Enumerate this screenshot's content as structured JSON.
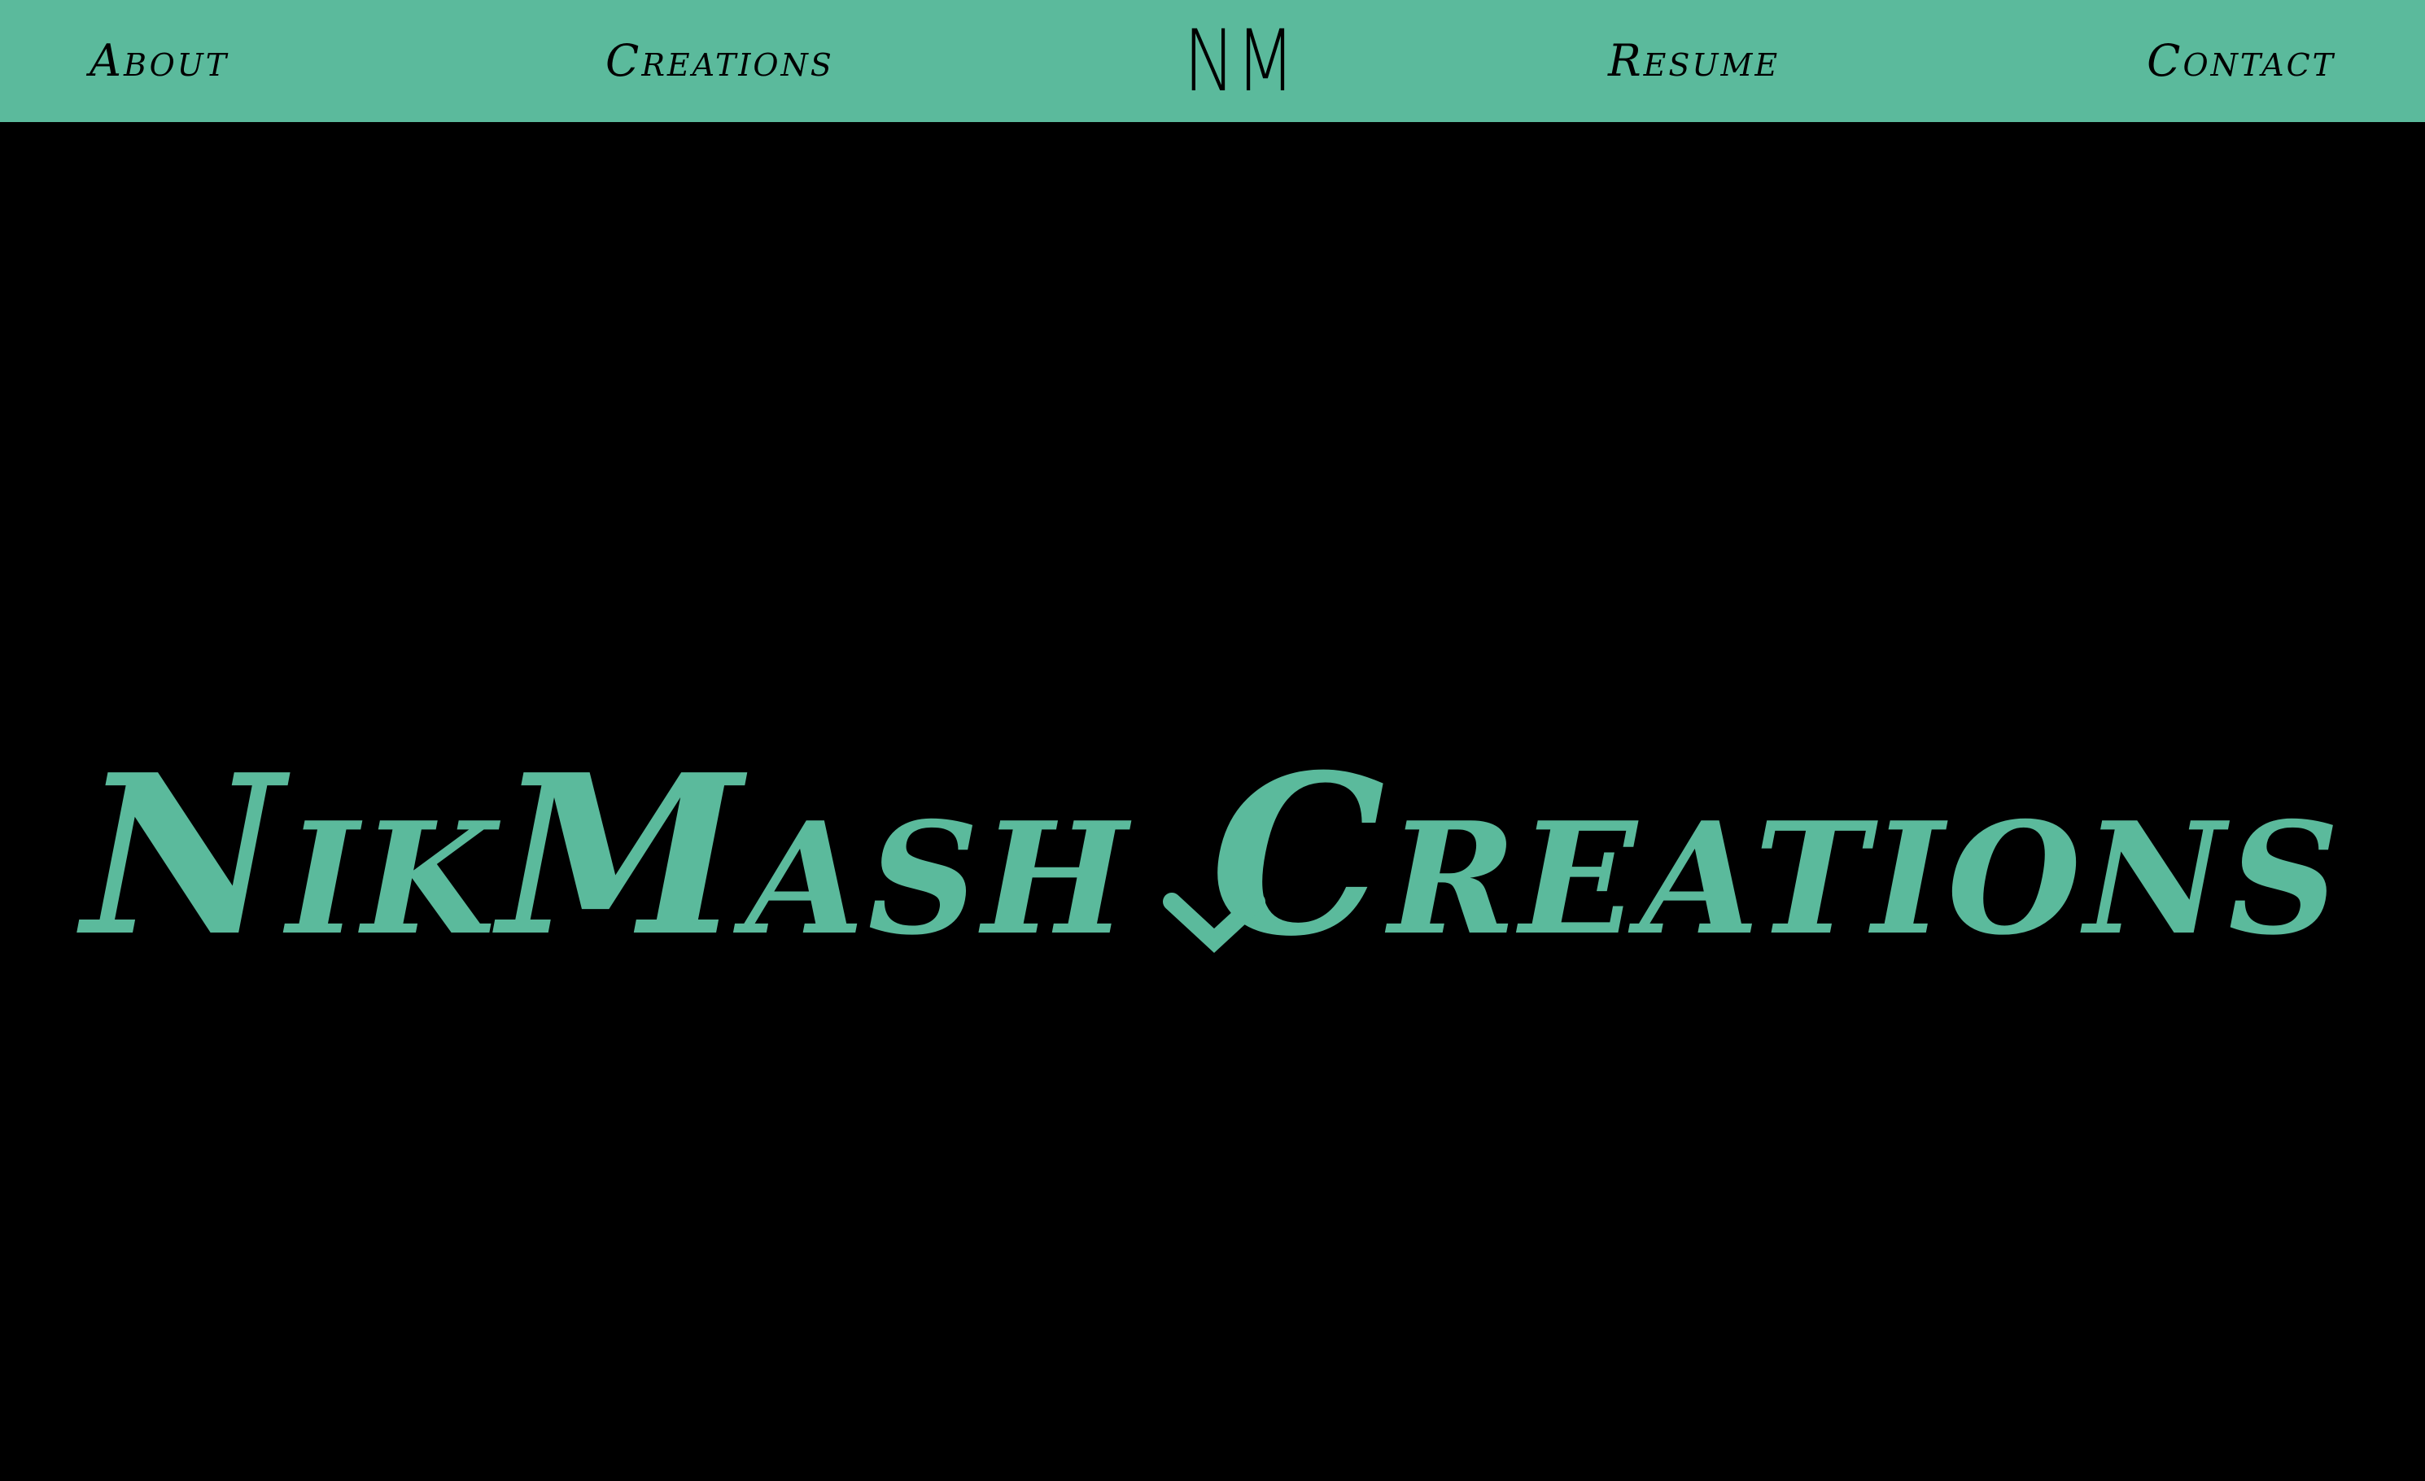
{
  "colors": {
    "accent": "#5BBA9C",
    "background": "#000000",
    "nav_text": "#000000"
  },
  "nav": {
    "about_label": "About",
    "creations_label": "Creations",
    "logo_text": "NM",
    "resume_label": "Resume",
    "contact_label": "Contact"
  },
  "hero": {
    "title": "NikMash Creations",
    "scroll_icon": "chevron-down-icon"
  }
}
